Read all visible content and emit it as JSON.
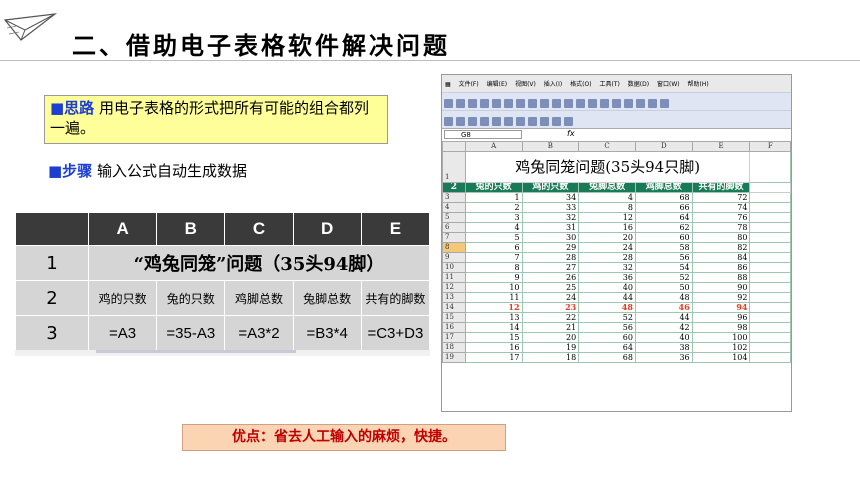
{
  "title": "二、借助电子表格软件解决问题",
  "idea": {
    "label": "■思路",
    "text": "用电子表格的形式把所有可能的组合都列一遍。"
  },
  "steps": {
    "label": "■步骤",
    "text": "输入公式自动生成数据"
  },
  "formula_table": {
    "col_headers": [
      "A",
      "B",
      "C",
      "D",
      "E"
    ],
    "row_numbers": [
      "1",
      "2",
      "3"
    ],
    "title_row": "“鸡兔同笼”问题（35头94脚）",
    "header_cells": [
      "鸡的只数",
      "兔的只数",
      "鸡脚总数",
      "兔脚总数",
      "共有的脚数"
    ],
    "formula_cells": [
      "=A3",
      "=35-A3",
      "=A3*2",
      "=B3*4",
      "=C3+D3"
    ]
  },
  "excel": {
    "menu": [
      "文件(F)",
      "编辑(E)",
      "视图(V)",
      "插入(I)",
      "格式(O)",
      "工具(T)",
      "数据(D)",
      "窗口(W)",
      "帮助(H)"
    ],
    "name_box": "G8",
    "fx": "fx",
    "col_headers": [
      "A",
      "B",
      "C",
      "D",
      "E",
      "F"
    ],
    "sheet_title": "鸡兔同笼问题(35头94只脚)",
    "header_row": [
      "兔的只数",
      "鸡的只数",
      "兔脚总数",
      "鸡脚总数",
      "共有的脚数"
    ],
    "rows": [
      {
        "n": "3",
        "v": [
          "1",
          "34",
          "4",
          "68",
          "72"
        ]
      },
      {
        "n": "4",
        "v": [
          "2",
          "33",
          "8",
          "66",
          "74"
        ]
      },
      {
        "n": "5",
        "v": [
          "3",
          "32",
          "12",
          "64",
          "76"
        ]
      },
      {
        "n": "6",
        "v": [
          "4",
          "31",
          "16",
          "62",
          "78"
        ]
      },
      {
        "n": "7",
        "v": [
          "5",
          "30",
          "20",
          "60",
          "80"
        ]
      },
      {
        "n": "8",
        "v": [
          "6",
          "29",
          "24",
          "58",
          "82"
        ]
      },
      {
        "n": "9",
        "v": [
          "7",
          "28",
          "28",
          "56",
          "84"
        ]
      },
      {
        "n": "10",
        "v": [
          "8",
          "27",
          "32",
          "54",
          "86"
        ]
      },
      {
        "n": "11",
        "v": [
          "9",
          "26",
          "36",
          "52",
          "88"
        ]
      },
      {
        "n": "12",
        "v": [
          "10",
          "25",
          "40",
          "50",
          "90"
        ]
      },
      {
        "n": "13",
        "v": [
          "11",
          "24",
          "44",
          "48",
          "92"
        ]
      },
      {
        "n": "14",
        "v": [
          "12",
          "23",
          "48",
          "46",
          "94"
        ]
      },
      {
        "n": "15",
        "v": [
          "13",
          "22",
          "52",
          "44",
          "96"
        ]
      },
      {
        "n": "16",
        "v": [
          "14",
          "21",
          "56",
          "42",
          "98"
        ]
      },
      {
        "n": "17",
        "v": [
          "15",
          "20",
          "60",
          "40",
          "100"
        ]
      },
      {
        "n": "18",
        "v": [
          "16",
          "19",
          "64",
          "38",
          "102"
        ]
      },
      {
        "n": "19",
        "v": [
          "17",
          "18",
          "68",
          "36",
          "104"
        ]
      }
    ],
    "selected_row": "8",
    "highlight_row": "14"
  },
  "advantage": "优点：省去人工输入的麻烦，快捷。",
  "colors": {
    "idea_bg": "#ffff99",
    "blue": "#1c3fd1",
    "table_header": "#3a3a3a",
    "table_row": "#d5d5d5",
    "excel_header": "#197a58",
    "highlight": "#e23a1c",
    "advantage_bg": "#fbd4b4",
    "advantage_text": "#c00000"
  }
}
